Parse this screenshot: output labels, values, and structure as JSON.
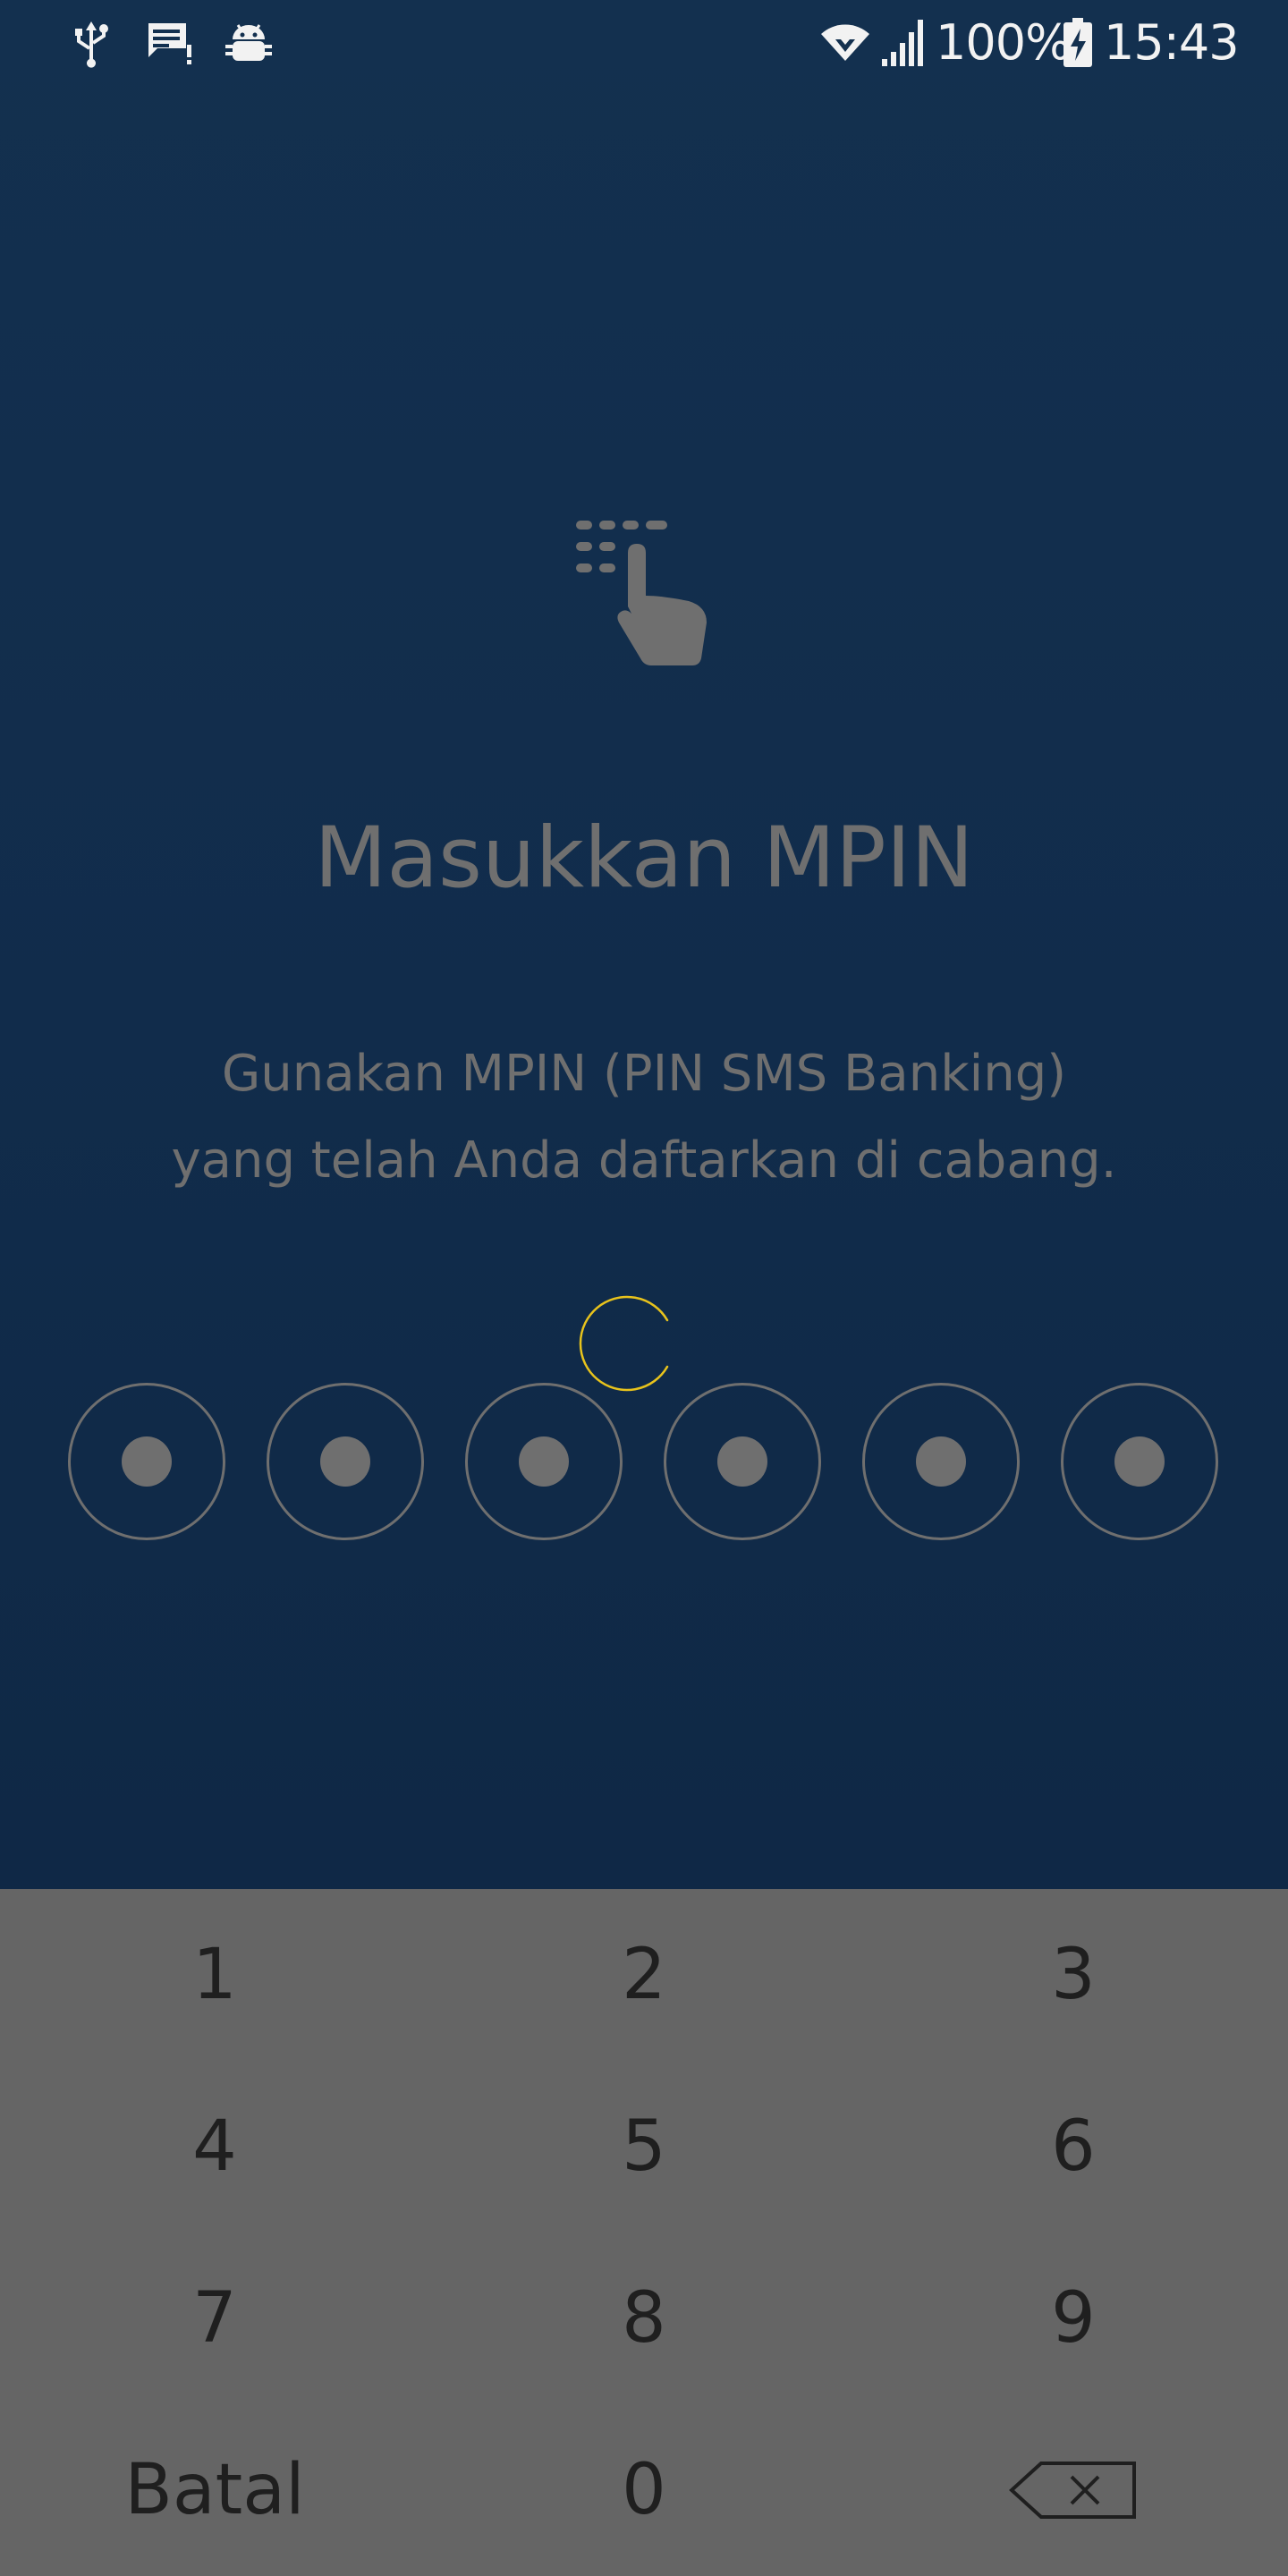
{
  "status_bar": {
    "battery_percent": "100%",
    "time": "15:43",
    "icons": [
      "usb-icon",
      "message-alert-icon",
      "android-debug-icon",
      "wifi-icon",
      "cell-signal-icon",
      "battery-charging-icon"
    ]
  },
  "screen": {
    "icon": "keypad-touch-icon",
    "title": "Masukkan MPIN",
    "subtitle_line1": "Gunakan MPIN (PIN SMS Banking)",
    "subtitle_line2": "yang telah Anda daftarkan di cabang.",
    "spinner_color": "#e8c31c",
    "pin_length": 6,
    "pin_filled": 6
  },
  "keypad": {
    "keys": [
      "1",
      "2",
      "3",
      "4",
      "5",
      "6",
      "7",
      "8",
      "9"
    ],
    "cancel_label": "Batal",
    "zero_label": "0",
    "backspace_icon": "backspace-icon"
  },
  "colors": {
    "background_top": "#13304f",
    "background_bottom": "#0d2541",
    "text_muted": "#6f6f6f",
    "keypad_bg": "#656565",
    "key_text": "#1f1f1f"
  }
}
